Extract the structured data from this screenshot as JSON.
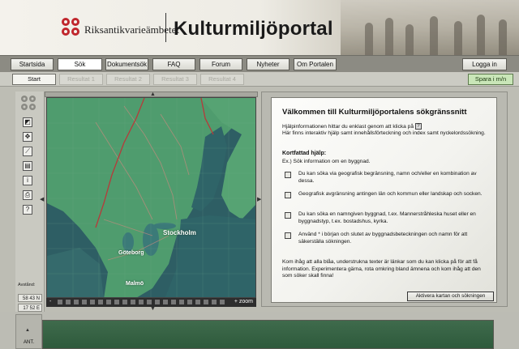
{
  "header": {
    "brand": "Riksantikvarieämbetet",
    "portal_title": "Kulturmiljöportal"
  },
  "nav": {
    "items": [
      {
        "label": "Startsida"
      },
      {
        "label": "Sök",
        "active": true
      },
      {
        "label": "Dokumentsök"
      },
      {
        "label": "FAQ"
      },
      {
        "label": "Forum"
      },
      {
        "label": "Nyheter"
      },
      {
        "label": "Om Portalen"
      }
    ],
    "login": "Logga in"
  },
  "tabs": {
    "items": [
      {
        "label": "Start",
        "active": true
      },
      {
        "label": "Resultat 1"
      },
      {
        "label": "Resultat 2"
      },
      {
        "label": "Resultat 3"
      },
      {
        "label": "Resultat 4"
      }
    ],
    "save": "Spara i m/n"
  },
  "tools": {
    "avstand_label": "Avstånd:",
    "north": "58 43 N",
    "east": "17 52 E"
  },
  "map": {
    "labels": {
      "stockholm": "Stockholm",
      "goteborg": "Göteborg",
      "malmo": "Malmö"
    },
    "zoom_label": "+ zoom",
    "colors": {
      "sea": "#2e5e64",
      "land": "#4f9c6e",
      "lake": "#3b7a78",
      "border": "#c0392b"
    }
  },
  "panel": {
    "title": "Välkommen till Kulturmiljöportalens sökgränssnitt",
    "intro_part1": "Hjälpinformationen hittar du enklast genom att klicka på",
    "intro_part2": "Här finns interaktiv hjälp samt innehållsförteckning och index samt nyckelordssökning.",
    "subtitle": "Kortfattad hjälp:",
    "example": "Ex.) Sök information om en byggnad.",
    "bullets": [
      "Du kan söka via geografisk begränsning, namn och/eller en kombination av dessa.",
      "Geografisk avgränsning antingen län och kommun eller landskap och socken.",
      "Du kan söka en namngiven byggnad, t.ex. Mannerstråhleska huset eller en byggnadstyp, t.ex. bostadshus, kyrka.",
      "Använd * i början och slutet av byggnadsbeteckningen och namn för att säkerställa sökningen."
    ],
    "note": "Kom ihåg att alla blåa, understrukna texter är länkar som du kan klicka på för att få information. Experimentera gärna, rota omkring bland ämnena och kom ihåg att den som söker skall finna!",
    "activate_button": "Aktivera kartan och sökningen"
  },
  "bottom": {
    "ant_label": "ANT."
  }
}
